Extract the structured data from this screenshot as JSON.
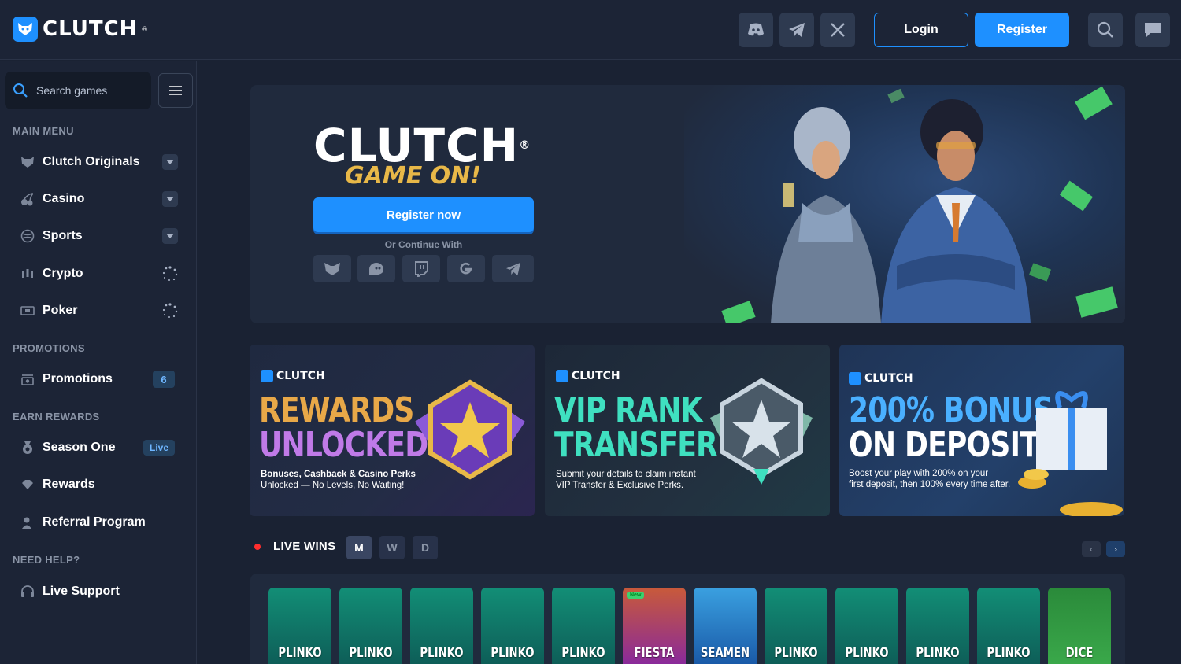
{
  "header": {
    "brand": "CLUTCH",
    "brand_mark": "®",
    "social_icons": [
      "discord-icon",
      "telegram-icon",
      "x-icon"
    ],
    "login_label": "Login",
    "register_label": "Register"
  },
  "sidebar": {
    "search_placeholder": "Search games",
    "sections": {
      "main_menu": "MAIN MENU",
      "promotions": "PROMOTIONS",
      "earn_rewards": "EARN REWARDS",
      "need_help": "NEED HELP?"
    },
    "main_items": [
      {
        "label": "Clutch Originals",
        "icon": "wolf-icon"
      },
      {
        "label": "Casino",
        "icon": "cherries-icon"
      },
      {
        "label": "Sports",
        "icon": "ball-icon"
      },
      {
        "label": "Crypto",
        "icon": "candlestick-icon"
      },
      {
        "label": "Poker",
        "icon": "cards-icon"
      }
    ],
    "promotions_item": {
      "label": "Promotions",
      "count": "6"
    },
    "rewards_items": [
      {
        "label": "Season One",
        "badge": "Live"
      },
      {
        "label": "Rewards"
      },
      {
        "label": "Referral Program"
      }
    ],
    "help_item": {
      "label": "Live Support"
    }
  },
  "hero": {
    "logo_text": "CLUTCH",
    "logo_mark": "®",
    "tagline": "GAME ON!",
    "register_label": "Register now",
    "continue_label": "Or Continue With",
    "social_logins": [
      "metamask-icon",
      "ghost-icon",
      "twitch-icon",
      "google-icon",
      "telegram-icon"
    ]
  },
  "promos": [
    {
      "brand": "CLUTCH",
      "title_1": "REWARDS",
      "title_2": "UNLOCKED",
      "desc_1": "Bonuses, Cashback & Casino Perks",
      "desc_2": "Unlocked — No Levels, No Waiting!"
    },
    {
      "brand": "CLUTCH",
      "title_1": "VIP RANK",
      "title_2": "TRANSFER",
      "desc_1": "Submit your details to claim instant",
      "desc_2": "VIP Transfer & Exclusive Perks."
    },
    {
      "brand": "CLUTCH",
      "title_1": "200% BONUS",
      "title_2": "ON DEPOSIT",
      "desc_1": "Boost your play with 200% on your",
      "desc_2": "first deposit, then 100% every time after."
    }
  ],
  "live_wins": {
    "title": "LIVE WINS",
    "periods": [
      "M",
      "W",
      "D"
    ],
    "active_period": "M",
    "prev": "‹",
    "next": "›"
  },
  "games": [
    {
      "name": "PLINKO"
    },
    {
      "name": "PLINKO"
    },
    {
      "name": "PLINKO"
    },
    {
      "name": "PLINKO"
    },
    {
      "name": "PLINKO"
    },
    {
      "name": "FIESTA",
      "badge": "New"
    },
    {
      "name": "SEAMEN"
    },
    {
      "name": "PLINKO"
    },
    {
      "name": "PLINKO"
    },
    {
      "name": "PLINKO"
    },
    {
      "name": "PLINKO"
    },
    {
      "name": "DICE"
    }
  ],
  "colors": {
    "accent": "#1e90ff",
    "background": "#1a2233",
    "panel": "#1c2436",
    "live": "#ff2e2e",
    "gold": "#e8b848"
  }
}
